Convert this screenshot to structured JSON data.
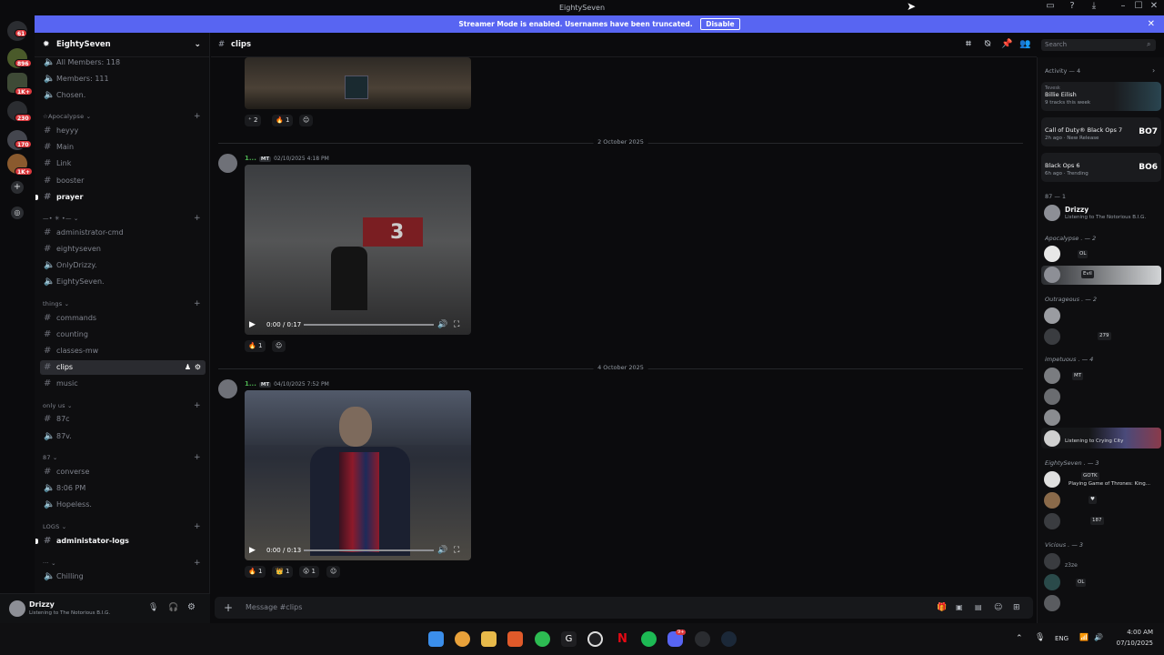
{
  "window": {
    "title": "EightySeven",
    "minimize": "–",
    "maximize": "☐",
    "close": "✕"
  },
  "banner": {
    "text": "Streamer Mode is enabled. Usernames have been truncated.",
    "button": "Disable",
    "close": "✕"
  },
  "guilds": {
    "badges": [
      "61",
      "896",
      "1K+",
      "230",
      "170",
      "1K+"
    ]
  },
  "server": {
    "name": "EightySeven",
    "chevron": "⌄"
  },
  "channels": {
    "top": [
      {
        "label": "All Members: 118"
      },
      {
        "label": "Members: 111"
      },
      {
        "label": "Chosen."
      }
    ],
    "cat_apocalypse": "☆Apocalypse ⌄",
    "apocalypse": [
      {
        "label": "heyyy"
      },
      {
        "label": "Main"
      },
      {
        "label": "Link"
      },
      {
        "label": "booster"
      },
      {
        "label": "prayer"
      }
    ],
    "cat_2": "—• ✳ •—  ⌄",
    "group2": [
      {
        "label": "administrator-cmd"
      },
      {
        "label": "eightyseven"
      },
      {
        "label": "OnlyDrizzy."
      },
      {
        "label": "EightySeven."
      }
    ],
    "cat_things": "things ⌄",
    "things": [
      {
        "label": "commands"
      },
      {
        "label": "counting"
      },
      {
        "label": "classes-mw"
      },
      {
        "label": "clips"
      },
      {
        "label": "music"
      }
    ],
    "cat_onlyus": "only us ⌄",
    "onlyus": [
      {
        "label": "87c"
      },
      {
        "label": "87v."
      }
    ],
    "cat_87": "87 ⌄",
    "c87": [
      {
        "label": "converse"
      },
      {
        "label": "8:06 PM"
      },
      {
        "label": "Hopeless."
      }
    ],
    "cat_logs": "LOGS ⌄",
    "logs": [
      {
        "label": "administator-logs"
      }
    ],
    "cat_misc": "··· ⌄",
    "misc": [
      {
        "label": "Chilling"
      }
    ],
    "plus": "+",
    "hash": "#"
  },
  "user": {
    "name": "Drizzy",
    "status": "Listening to The Notorious B.I.G."
  },
  "header": {
    "channel": "clips",
    "search_placeholder": "Search"
  },
  "messages": {
    "first": {
      "reactions": [
        {
          "emoji": "⁺",
          "count": "2"
        },
        {
          "emoji": "🔥",
          "count": "1"
        },
        {
          "emoji": "☺",
          "count": ""
        }
      ]
    },
    "div1": "2 October 2025",
    "m2": {
      "name": "1...",
      "tag": "MT",
      "time": "02/10/2025 4:18 PM",
      "video_time": "0:00 / 0:17",
      "reactions": [
        {
          "emoji": "🔥",
          "count": "1"
        },
        {
          "emoji": "☺",
          "count": ""
        }
      ]
    },
    "div2": "4 October 2025",
    "m3": {
      "name": "1...",
      "tag": "MT",
      "time": "04/10/2025 7:52 PM",
      "video_time": "0:00 / 0:13",
      "reactions": [
        {
          "emoji": "🔥",
          "count": "1"
        },
        {
          "emoji": "👑",
          "count": "1"
        },
        {
          "emoji": "😮",
          "count": "1"
        },
        {
          "emoji": "☺",
          "count": ""
        }
      ]
    }
  },
  "composer": {
    "placeholder": "Message #clips"
  },
  "members": {
    "activity_label": "Activity — 4",
    "cards": [
      {
        "top": "Tevesk",
        "title": "Billie Eilish",
        "sub": "9 tracks this week"
      },
      {
        "title": "Call of Duty® Black Ops 7",
        "sub": "2h ago · New Release",
        "logo": "BO7"
      },
      {
        "title": "Black Ops 6",
        "sub": "6h ago · Trending",
        "logo": "BO6"
      }
    ],
    "sec87": "87 — 1",
    "drizzy": {
      "name": "Drizzy",
      "status": "Listening to The Notorious B.I.G."
    },
    "sec_apoc": "Apocalypse . — 2",
    "apoc_pills": [
      "OL",
      "Evil"
    ],
    "sec_outr": "Outrageous . — 2",
    "outr_pill": "279",
    "sec_imp": "impetuous . — 4",
    "imp_pill": "MT",
    "imp_status": "Listening to Crying City",
    "sec_87b": "EightySeven . — 3",
    "e_pill": "GOTK",
    "e_status": "Playing Game of Thrones: King...",
    "e_pill2": "187",
    "sec_vic": "Vicious . — 3",
    "vic_name": "z3ze",
    "vic_pill": "OL"
  },
  "taskbar": {
    "lang": "ENG",
    "time": "4:00 AM",
    "date": "07/10/2025",
    "discord_badge": "9+"
  }
}
